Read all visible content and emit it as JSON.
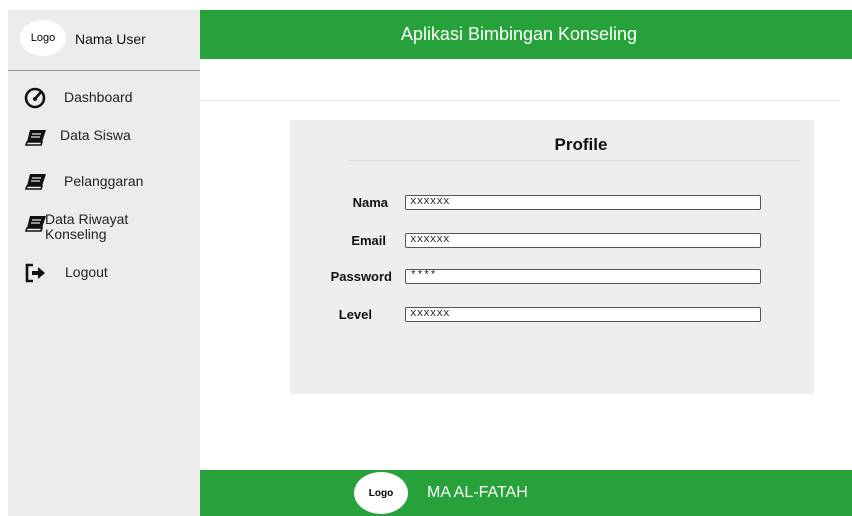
{
  "sidebar": {
    "logo": "Logo",
    "user_name": "Nama User",
    "items": [
      {
        "label": "Dashboard",
        "icon": "speedometer-icon"
      },
      {
        "label": "Data Siswa",
        "icon": "book-icon"
      },
      {
        "label": "Pelanggaran",
        "icon": "book-icon"
      },
      {
        "label": "Data Riwayat\nKonseling",
        "icon": "book-icon"
      },
      {
        "label": "Logout",
        "icon": "sign-out-icon"
      }
    ]
  },
  "header": {
    "title": "Aplikasi Bimbingan Konseling"
  },
  "profile": {
    "title": "Profile",
    "fields": [
      {
        "label": "Nama",
        "value": "xxxxxx"
      },
      {
        "label": "Email",
        "value": "xxxxxx"
      },
      {
        "label": "Password",
        "value": "****"
      },
      {
        "label": "Level",
        "value": "xxxxxx"
      }
    ]
  },
  "footer": {
    "logo": "Logo",
    "name": "MA AL-FATAH"
  },
  "colors": {
    "accent": "#27a23a",
    "sidebar_bg": "#ececec",
    "card_bg": "#eeeeee"
  }
}
